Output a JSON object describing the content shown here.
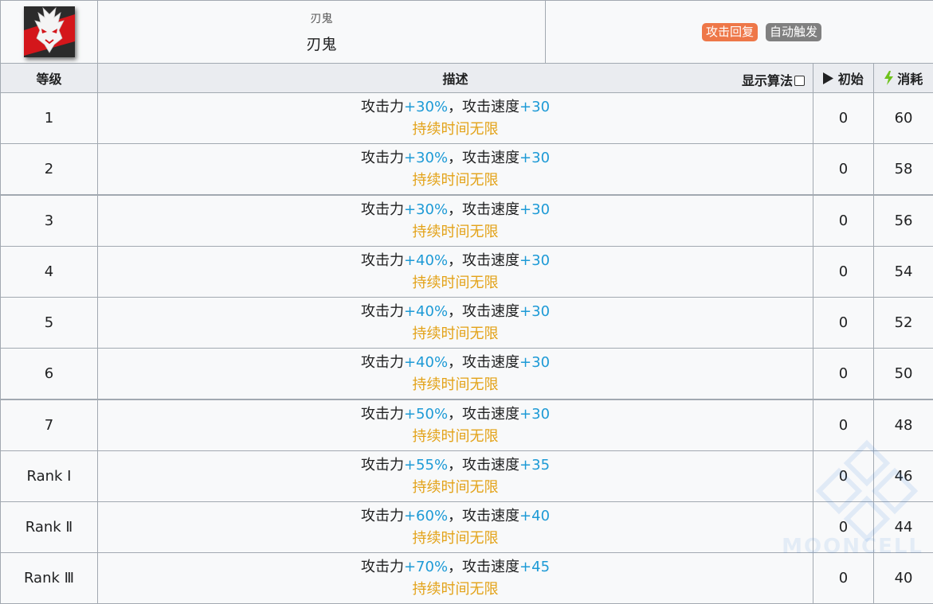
{
  "skill": {
    "category": "刃鬼",
    "name": "刃鬼",
    "tags": [
      {
        "label": "攻击回复",
        "color": "#ee7748"
      },
      {
        "label": "自动触发",
        "color": "#808080"
      }
    ],
    "icon": "demon-mask-icon"
  },
  "headers": {
    "level": "等级",
    "description": "描述",
    "show_algorithm": "显示算法",
    "initial": "初始",
    "cost": "消耗"
  },
  "rows": [
    {
      "level": "1",
      "atk_label": "攻击力",
      "atk": "+30%",
      "sep": "，",
      "spd_label": "攻击速度",
      "spd": "+30",
      "duration": "持续时间无限",
      "initial": "0",
      "cost": "60"
    },
    {
      "level": "2",
      "atk_label": "攻击力",
      "atk": "+30%",
      "sep": "，",
      "spd_label": "攻击速度",
      "spd": "+30",
      "duration": "持续时间无限",
      "initial": "0",
      "cost": "58"
    },
    {
      "level": "3",
      "atk_label": "攻击力",
      "atk": "+30%",
      "sep": "，",
      "spd_label": "攻击速度",
      "spd": "+30",
      "duration": "持续时间无限",
      "initial": "0",
      "cost": "56"
    },
    {
      "level": "4",
      "atk_label": "攻击力",
      "atk": "+40%",
      "sep": "，",
      "spd_label": "攻击速度",
      "spd": "+30",
      "duration": "持续时间无限",
      "initial": "0",
      "cost": "54"
    },
    {
      "level": "5",
      "atk_label": "攻击力",
      "atk": "+40%",
      "sep": "，",
      "spd_label": "攻击速度",
      "spd": "+30",
      "duration": "持续时间无限",
      "initial": "0",
      "cost": "52"
    },
    {
      "level": "6",
      "atk_label": "攻击力",
      "atk": "+40%",
      "sep": "，",
      "spd_label": "攻击速度",
      "spd": "+30",
      "duration": "持续时间无限",
      "initial": "0",
      "cost": "50"
    },
    {
      "level": "7",
      "atk_label": "攻击力",
      "atk": "+50%",
      "sep": "，",
      "spd_label": "攻击速度",
      "spd": "+30",
      "duration": "持续时间无限",
      "initial": "0",
      "cost": "48"
    },
    {
      "level": "Rank Ⅰ",
      "atk_label": "攻击力",
      "atk": "+55%",
      "sep": "，",
      "spd_label": "攻击速度",
      "spd": "+35",
      "duration": "持续时间无限",
      "initial": "0",
      "cost": "46"
    },
    {
      "level": "Rank Ⅱ",
      "atk_label": "攻击力",
      "atk": "+60%",
      "sep": "，",
      "spd_label": "攻击速度",
      "spd": "+40",
      "duration": "持续时间无限",
      "initial": "0",
      "cost": "44"
    },
    {
      "level": "Rank Ⅲ",
      "atk_label": "攻击力",
      "atk": "+70%",
      "sep": "，",
      "spd_label": "攻击速度",
      "spd": "+45",
      "duration": "持续时间无限",
      "initial": "0",
      "cost": "40"
    }
  ],
  "watermark": "MOONCELL"
}
